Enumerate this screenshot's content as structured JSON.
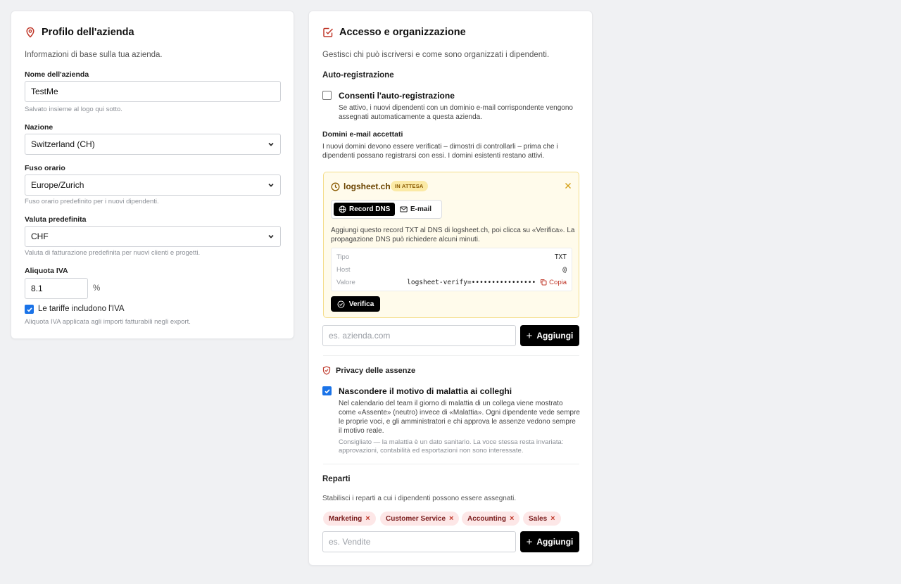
{
  "company_profile": {
    "title": "Profilo dell'azienda",
    "description": "Informazioni di base sulla tua azienda.",
    "company_name": {
      "label": "Nome dell'azienda",
      "value": "TestMe",
      "hint": "Salvato insieme al logo qui sotto."
    },
    "country": {
      "label": "Nazione",
      "value": "Switzerland (CH)"
    },
    "timezone": {
      "label": "Fuso orario",
      "value": "Europe/Zurich",
      "hint": "Fuso orario predefinito per i nuovi dipendenti."
    },
    "currency": {
      "label": "Valuta predefinita",
      "value": "CHF",
      "hint": "Valuta di fatturazione predefinita per nuovi clienti e progetti."
    },
    "vat": {
      "label": "Aliquota IVA",
      "value": "8.1",
      "unit": "%",
      "checkbox_label": "Le tariffe includono l'IVA",
      "checked": true,
      "hint": "Aliquota IVA applicata agli importi fatturabili negli export."
    }
  },
  "access": {
    "title": "Accesso e organizzazione",
    "description": "Gestisci chi può iscriversi e come sono organizzati i dipendenti.",
    "self_registration": {
      "heading": "Auto-registrazione",
      "checkbox_label": "Consenti l'auto-registrazione",
      "checked": false,
      "help_line1": "Se attivo, i nuovi dipendenti con un dominio e-mail corrispondente vengono",
      "help_line2": "assegnati automaticamente a questa azienda."
    },
    "domains": {
      "heading": "Domini e-mail accettati",
      "help_line1": "I nuovi domini devono essere verificati – dimostri di controllarli – prima che i",
      "help_line2": "dipendenti possano registrarsi con essi. I domini esistenti restano attivi.",
      "pending": {
        "domain": "logsheet.ch",
        "status": "IN ATTESA",
        "tab_dns": "Record DNS",
        "tab_email": "E-mail",
        "instructions_line1": "Aggiungi questo record TXT al DNS di logsheet.ch, poi clicca su «Verifica». La",
        "instructions_line2": "propagazione DNS può richiedere alcuni minuti.",
        "rows": [
          {
            "key": "Tipo",
            "value": "TXT"
          },
          {
            "key": "Host",
            "value": "@"
          },
          {
            "key": "Valore",
            "value": "logsheet-verify=••••••••••••••••"
          }
        ],
        "copy_label": "Copia",
        "verify_label": "Verifica"
      },
      "input_placeholder": "es. azienda.com",
      "add_label": "Aggiungi"
    },
    "privacy": {
      "heading": "Privacy delle assenze",
      "checkbox_label": "Nascondere il motivo di malattia ai colleghi",
      "checked": true,
      "help_line1": "Nel calendario del team il giorno di malattia di un collega viene mostrato",
      "help_line2": "come «Assente» (neutro) invece di «Malattia». Ogni dipendente vede sempre",
      "help_line3": "le proprie voci, e gli amministratori e chi approva le assenze vedono sempre",
      "help_line4": "il motivo reale.",
      "note_line1": "Consigliato — la malattia è un dato sanitario. La voce stessa resta invariata:",
      "note_line2": "approvazioni, contabilità ed esportazioni non sono interessate."
    },
    "departments": {
      "heading": "Reparti",
      "description": "Stabilisci i reparti a cui i dipendenti possono essere assegnati.",
      "tags": [
        "Marketing",
        "Customer Service",
        "Accounting",
        "Sales"
      ],
      "input_placeholder": "es. Vendite",
      "add_label": "Aggiungi"
    }
  },
  "colors": {
    "accent_red": "#c0392b",
    "checkbox_blue": "#1a73e8",
    "pending_bg": "#fffbeb"
  }
}
